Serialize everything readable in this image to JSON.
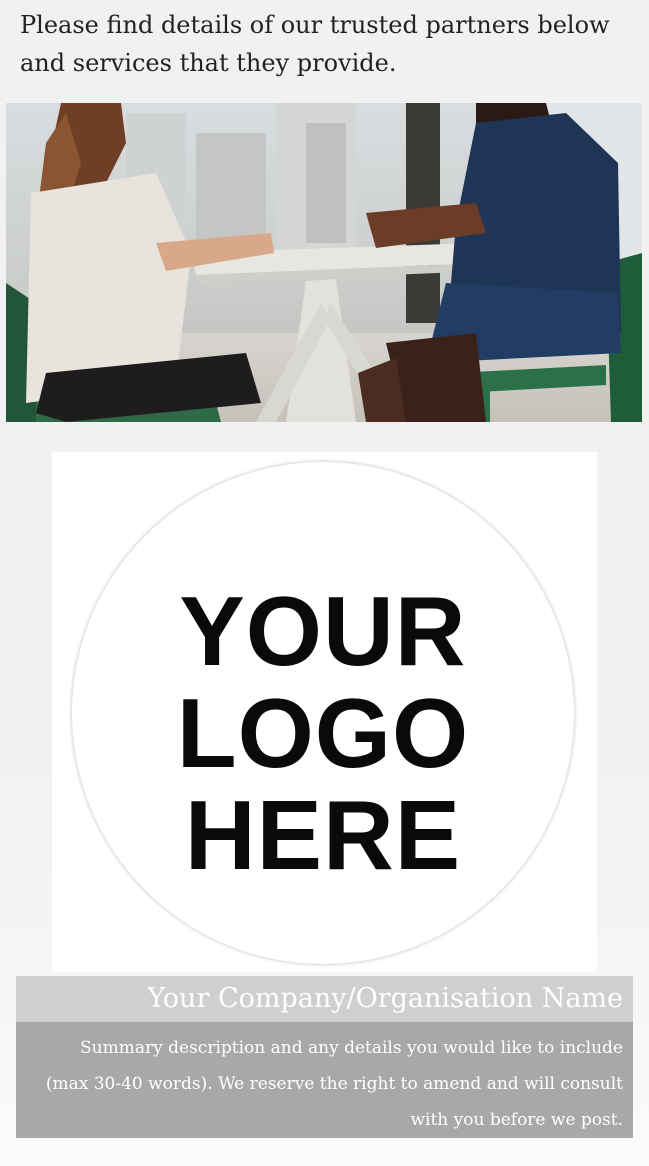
{
  "intro": {
    "text": "Please find details of our trusted partners below and services that they provide."
  },
  "photo": {
    "description_icon": "meeting-photo"
  },
  "logo": {
    "line1": "YOUR",
    "line2": "LOGO",
    "line3": "HERE"
  },
  "partner": {
    "name": "Your Company/Organisation Name",
    "description": "Summary description and any details you would like to include (max 30-40 words). We reserve the right to amend and will consult with you before we post."
  },
  "colors": {
    "name_bar": "#cfcfcf",
    "description_box": "#a8a8a8",
    "text_light": "#ffffff",
    "text_dark": "#222222"
  }
}
